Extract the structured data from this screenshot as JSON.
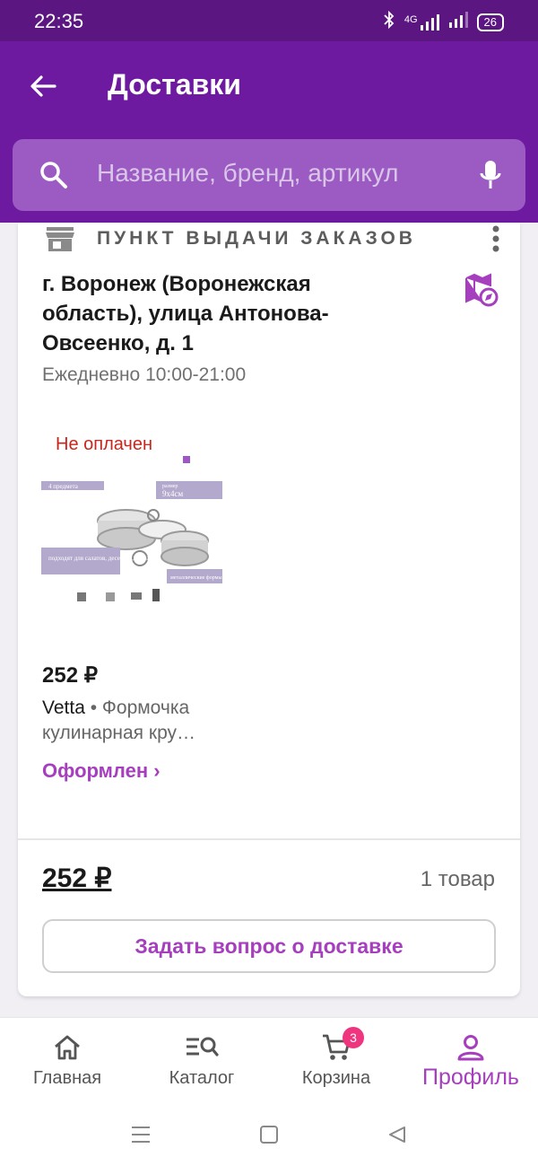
{
  "status_bar": {
    "time": "22:35",
    "network": "4G",
    "battery": "26"
  },
  "header": {
    "title": "Доставки"
  },
  "search": {
    "placeholder": "Название, бренд, артикул"
  },
  "delivery": {
    "type_label": "ПУНКТ ВЫДАЧИ ЗАКАЗОВ",
    "address": "г. Воронеж (Воронежская область), улица Антонова-Овсеенко, д. 1",
    "hours": "Ежедневно 10:00-21:00",
    "item": {
      "payment_status": "Не оплачен",
      "price": "252 ₽",
      "brand": "Vetta",
      "separator": " • ",
      "name": "Формочка кулинарная кру…",
      "status": "Оформлен ›",
      "image_labels": {
        "pieces": "4 предмета",
        "size_label": "размер",
        "size": "9х4см",
        "usage": "подходят для салатов, десертов, теста",
        "material": "металлические формы"
      }
    },
    "total": "252 ₽",
    "items_count": "1 товар",
    "ask_button": "Задать вопрос о доставке"
  },
  "bottom_nav": [
    {
      "label": "Главная",
      "icon": "home-icon"
    },
    {
      "label": "Каталог",
      "icon": "catalog-search-icon"
    },
    {
      "label": "Корзина",
      "icon": "cart-icon",
      "badge": "3"
    },
    {
      "label": "Профиль",
      "icon": "profile-icon",
      "active": true
    }
  ],
  "colors": {
    "header": "#6d1aa0",
    "status_bar": "#5b1681",
    "accent": "#a63fbd",
    "error": "#c8261d",
    "badge": "#f0357f"
  }
}
